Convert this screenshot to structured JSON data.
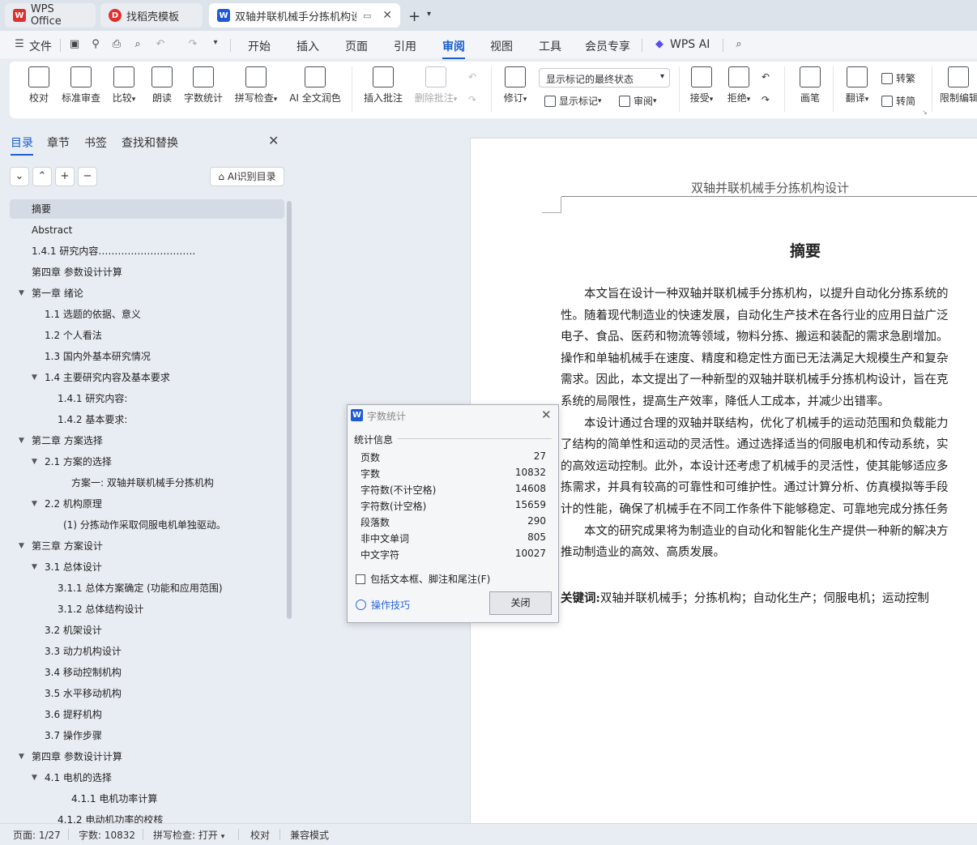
{
  "tabs": {
    "wps": {
      "label": "WPS Office",
      "icon": "wps-logo-icon",
      "color": "#e0302d"
    },
    "templates": {
      "label": "找稻壳模板",
      "icon": "docer-logo-icon",
      "color": "#e0302d"
    },
    "doc": {
      "label": "双轴并联机械手分拣机构设计",
      "icon": "word-doc-icon",
      "color": "#1f5ad6"
    }
  },
  "menubar": {
    "file": "文件",
    "items": [
      "开始",
      "插入",
      "页面",
      "引用",
      "审阅",
      "视图",
      "工具",
      "会员专享"
    ],
    "active": "审阅",
    "wps_ai": "WPS AI"
  },
  "ribbon": {
    "proofread": "校对",
    "standard_review": "标准审查",
    "compare": "比较",
    "read_aloud": "朗读",
    "word_count": "字数统计",
    "spell_check": "拼写检查",
    "ai_polish": "AI 全文润色",
    "insert_comment": "插入批注",
    "delete_comment": "删除批注",
    "markup_state": "显示标记的最终状态",
    "track_changes": "修订",
    "show_markup": "显示标记",
    "review_pane": "审阅",
    "accept": "接受",
    "reject": "拒绝",
    "pen": "画笔",
    "translate": "翻译",
    "to_traditional": "转繁",
    "to_simplified": "转简",
    "restrict_edit": "限制编辑"
  },
  "nav": {
    "tabs": [
      "目录",
      "章节",
      "书签",
      "查找和替换"
    ],
    "active_tab": "目录",
    "ai_toc": "AI识别目录",
    "items": [
      {
        "label": "摘要",
        "indent": 0,
        "arrow": false,
        "selected": true
      },
      {
        "label": "Abstract",
        "indent": 0,
        "arrow": false
      },
      {
        "label": "1.4.1  研究内容…………………………",
        "indent": 0,
        "arrow": false
      },
      {
        "label": "第四章  参数设计计算",
        "indent": 0,
        "arrow": false
      },
      {
        "label": "第一章  绪论",
        "indent": 0,
        "arrow": true
      },
      {
        "label": "1.1 选题的依据、意义",
        "indent": 1,
        "arrow": false
      },
      {
        "label": "1.2   个人看法",
        "indent": 1,
        "arrow": false
      },
      {
        "label": "1.3   国内外基本研究情况",
        "indent": 1,
        "arrow": false
      },
      {
        "label": "1.4   主要研究内容及基本要求",
        "indent": 1,
        "arrow": true
      },
      {
        "label": "1.4.1   研究内容:",
        "indent": 2,
        "arrow": false
      },
      {
        "label": "1.4.2   基本要求:",
        "indent": 2,
        "arrow": false
      },
      {
        "label": "第二章  方案选择",
        "indent": 0,
        "arrow": true
      },
      {
        "label": "2.1  方案的选择",
        "indent": 1,
        "arrow": true
      },
      {
        "label": "方案一: 双轴并联机械手分拣机构",
        "indent": 3,
        "arrow": false
      },
      {
        "label": "2.2  机构原理",
        "indent": 1,
        "arrow": true
      },
      {
        "label": "(1) 分拣动作采取伺服电机单独驱动。",
        "indent": 2.5,
        "arrow": false
      },
      {
        "label": "第三章   方案设计",
        "indent": 0,
        "arrow": true
      },
      {
        "label": "3.1    总体设计",
        "indent": 1,
        "arrow": true
      },
      {
        "label": "3.1.1  总体方案确定 (功能和应用范围)",
        "indent": 2,
        "arrow": false
      },
      {
        "label": "3.1.2  总体结构设计",
        "indent": 2,
        "arrow": false
      },
      {
        "label": "3.2   机架设计",
        "indent": 1,
        "arrow": false
      },
      {
        "label": "3.3   动力机构设计",
        "indent": 1,
        "arrow": false
      },
      {
        "label": "3.4   移动控制机构",
        "indent": 1,
        "arrow": false
      },
      {
        "label": "3.5   水平移动机构",
        "indent": 1,
        "arrow": false
      },
      {
        "label": "3.6   提籽机构",
        "indent": 1,
        "arrow": false
      },
      {
        "label": "3.7   操作步骤",
        "indent": 1,
        "arrow": false
      },
      {
        "label": "第四章  参数设计计算",
        "indent": 0,
        "arrow": true
      },
      {
        "label": "4.1  电机的选择",
        "indent": 1,
        "arrow": true
      },
      {
        "label": "4.1.1  电机功率计算",
        "indent": 3,
        "arrow": false
      },
      {
        "label": "4.1.2  电动机功率的校核",
        "indent": 2,
        "arrow": false
      }
    ]
  },
  "document": {
    "header": "双轴并联机械手分拣机构设计",
    "title": "摘要",
    "heading_mark": "H₁",
    "lines": [
      "　　本文旨在设计一种双轴并联机械手分拣机构，以提升自动化分拣系统的",
      "性。随着现代制造业的快速发展，自动化生产技术在各行业的应用日益广泛",
      "电子、食品、医药和物流等领域，物料分拣、搬运和装配的需求急剧增加。",
      "操作和单轴机械手在速度、精度和稳定性方面已无法满足大规模生产和复杂",
      "需求。因此，本文提出了一种新型的双轴并联机械手分拣机构设计，旨在克",
      "系统的局限性，提高生产效率，降低人工成本，并减少出错率。",
      "　　本设计通过合理的双轴并联结构，优化了机械手的运动范围和负载能力",
      "了结构的简单性和运动的灵活性。通过选择适当的伺服电机和传动系统，实",
      "的高效运动控制。此外，本设计还考虑了机械手的灵活性，使其能够适应多",
      "拣需求，并具有较高的可靠性和可维护性。通过计算分析、仿真模拟等手段",
      "计的性能，确保了机械手在不同工作条件下能够稳定、可靠地完成分拣任务",
      "　　本文的研究成果将为制造业的自动化和智能化生产提供一种新的解决方",
      "推动制造业的高效、高质发展。"
    ],
    "keywords_label": "关键词:",
    "keywords": "双轴并联机械手；分拣机构；自动化生产；伺服电机；运动控制"
  },
  "dialog": {
    "title": "字数统计",
    "section": "统计信息",
    "stats": [
      {
        "label": "页数",
        "value": "27"
      },
      {
        "label": "字数",
        "value": "10832"
      },
      {
        "label": "字符数(不计空格)",
        "value": "14608"
      },
      {
        "label": "字符数(计空格)",
        "value": "15659"
      },
      {
        "label": "段落数",
        "value": "290"
      },
      {
        "label": "非中文单词",
        "value": "805"
      },
      {
        "label": "中文字符",
        "value": "10027"
      }
    ],
    "include_label": "包括文本框、脚注和尾注(F)",
    "tips": "操作技巧",
    "close": "关闭"
  },
  "status": {
    "page": "页面: 1/27",
    "words": "字数: 10832",
    "spell": "拼写检查: 打开",
    "proofread": "校对",
    "compat": "兼容模式"
  }
}
